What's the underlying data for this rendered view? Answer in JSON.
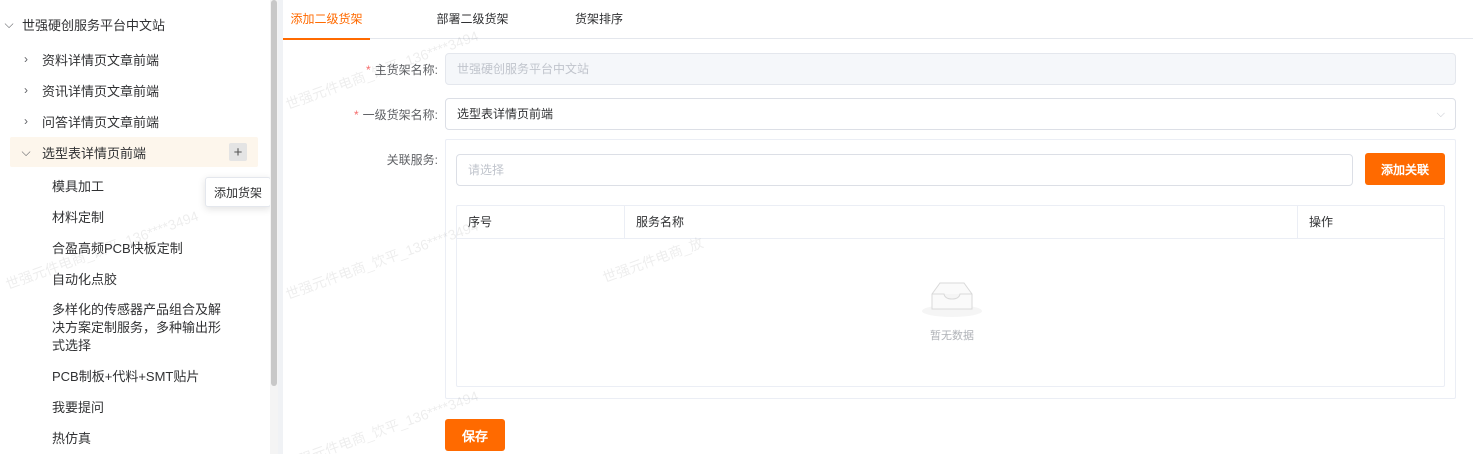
{
  "sidebar": {
    "root": {
      "label": "世强硬创服务平台中文站",
      "expanded": true
    },
    "groups": [
      {
        "label": "资料详情页文章前端",
        "expanded": false
      },
      {
        "label": "资讯详情页文章前端",
        "expanded": false
      },
      {
        "label": "问答详情页文章前端",
        "expanded": false
      },
      {
        "label": "选型表详情页前端",
        "expanded": true,
        "active": true
      }
    ],
    "plus_symbol": "+",
    "tooltip": "添加货架",
    "leaves": [
      "模具加工",
      "材料定制",
      "合盈高频PCB快板定制",
      "自动化点胶",
      "多样化的传感器产品组合及解",
      "决方案定制服务，多种输出形",
      "式选择",
      "PCB制板+代料+SMT贴片",
      "我要提问",
      "热仿真"
    ]
  },
  "tabs": [
    {
      "label": "添加二级货架",
      "active": true
    },
    {
      "label": "部署二级货架",
      "active": false
    },
    {
      "label": "货架排序",
      "active": false
    }
  ],
  "form": {
    "main_shelf": {
      "label": "主货架名称:",
      "value": "世强硬创服务平台中文站",
      "required": true,
      "disabled": true
    },
    "level1_shelf": {
      "label": "一级货架名称:",
      "value": "选型表详情页前端",
      "required": true
    },
    "related_service": {
      "label": "关联服务:",
      "placeholder": "请选择"
    },
    "add_link_button": "添加关联",
    "table": {
      "columns": [
        "序号",
        "服务名称",
        "操作"
      ],
      "rows": [],
      "empty_text": "暂无数据"
    },
    "save_button": "保存"
  },
  "required_mark": "*",
  "colors": {
    "accent": "#ff6a00",
    "required": "#f56c6c"
  },
  "icons": {
    "collapsed": "chevron-right-icon",
    "expanded": "chevron-down-icon",
    "empty": "empty-box-icon"
  },
  "watermark": {
    "text_a": "世强元件电商_饮平_136****3494",
    "text_b": "世强元件电商_放"
  }
}
